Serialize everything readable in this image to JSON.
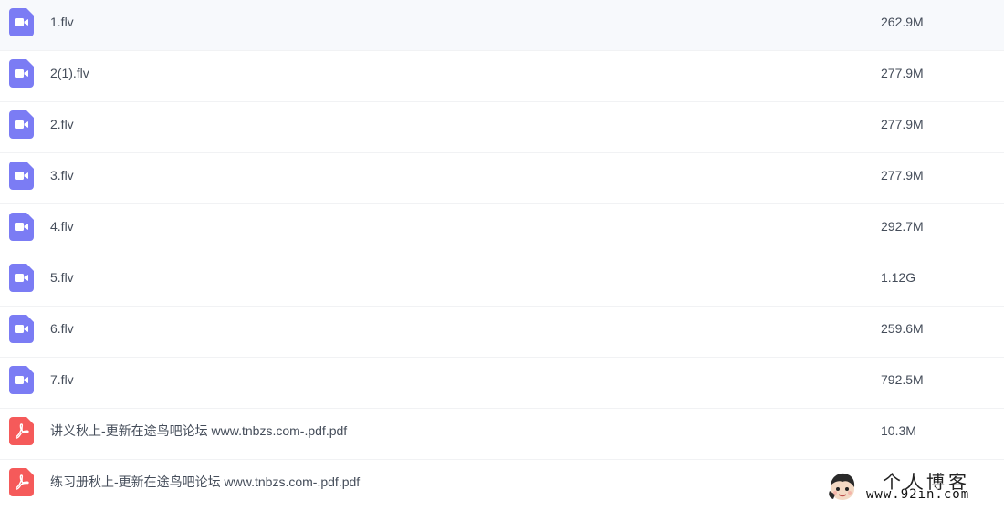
{
  "files": [
    {
      "name": "1.flv",
      "size": "262.9M",
      "type": "video"
    },
    {
      "name": "2(1).flv",
      "size": "277.9M",
      "type": "video"
    },
    {
      "name": "2.flv",
      "size": "277.9M",
      "type": "video"
    },
    {
      "name": "3.flv",
      "size": "277.9M",
      "type": "video"
    },
    {
      "name": "4.flv",
      "size": "292.7M",
      "type": "video"
    },
    {
      "name": "5.flv",
      "size": "1.12G",
      "type": "video"
    },
    {
      "name": "6.flv",
      "size": "259.6M",
      "type": "video"
    },
    {
      "name": "7.flv",
      "size": "792.5M",
      "type": "video"
    },
    {
      "name": "讲义秋上-更新在途鸟吧论坛 www.tnbzs.com-.pdf.pdf",
      "size": "10.3M",
      "type": "pdf"
    },
    {
      "name": "练习册秋上-更新在途鸟吧论坛 www.tnbzs.com-.pdf.pdf",
      "size": "",
      "type": "pdf"
    }
  ],
  "icons": {
    "video": {
      "name": "video-file-icon",
      "color": "#7b7cf4"
    },
    "pdf": {
      "name": "pdf-file-icon",
      "color": "#f55a5a"
    }
  },
  "watermark": {
    "title": "个人博客",
    "url": "www.92in.com"
  }
}
